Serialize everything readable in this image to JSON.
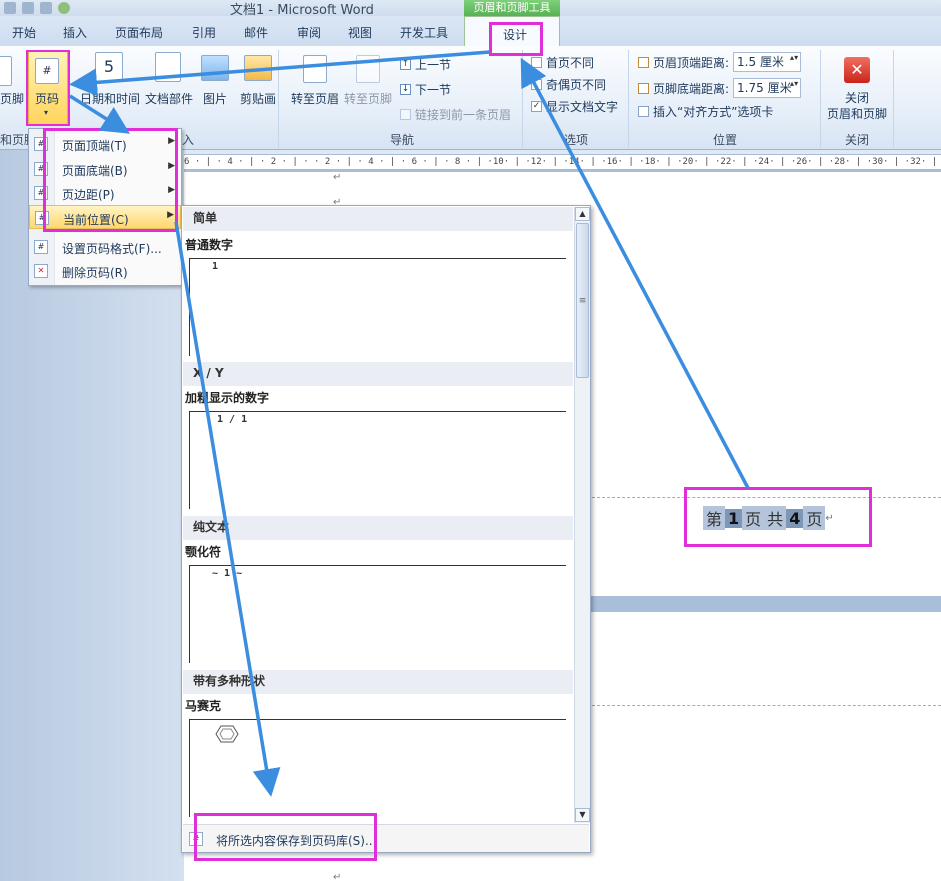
{
  "window": {
    "title": "文档1 - Microsoft Word",
    "context_tab_group": "页眉和页脚工具"
  },
  "tabs": {
    "items": [
      "开始",
      "插入",
      "页面布局",
      "引用",
      "邮件",
      "审阅",
      "视图",
      "开发工具"
    ],
    "active": "设计"
  },
  "ribbon": {
    "footer_partial": "页脚",
    "page_number": "页码",
    "date_time": "日期和时间",
    "doc_parts": "文档部件",
    "picture": "图片",
    "clipart": "剪贴画",
    "insert_group_partial": "入",
    "header_footer_group_partial": "和页脚",
    "goto_header": "转至页眉",
    "goto_footer": "转至页脚",
    "prev_section": "上一节",
    "next_section": "下一节",
    "link_prev": "链接到前一条页眉",
    "navigation_group": "导航",
    "diff_first": "首页不同",
    "diff_odd_even": "奇偶页不同",
    "show_doc_text": "显示文档文字",
    "options_group": "选项",
    "header_top_label": "页眉顶端距离:",
    "header_top_value": "1.5 厘米",
    "footer_bottom_label": "页脚底端距离:",
    "footer_bottom_value": "1.75 厘米",
    "insert_align_tab": "插入“对齐方式”选项卡",
    "position_group": "位置",
    "close_line1": "关闭",
    "close_line2": "页眉和页脚",
    "close_group": "关闭"
  },
  "ruler": {
    "text": "6 · | · 4 · | · 2 · | ·    · 2 · | · 4 · | · 6 · | · 8 · | ·10· | ·12· | ·14· | ·16· | ·18· | ·20· | ·22· | ·24· | ·26· | ·28· | ·30· | ·32· | ·34"
  },
  "menu": {
    "items": [
      {
        "label": "页面顶端(T)",
        "submenu": true
      },
      {
        "label": "页面底端(B)",
        "submenu": true
      },
      {
        "label": "页边距(P)",
        "submenu": true
      },
      {
        "label": "当前位置(C)",
        "submenu": true
      },
      {
        "label": "设置页码格式(F)...",
        "submenu": false
      },
      {
        "label": "删除页码(R)",
        "submenu": false
      }
    ]
  },
  "gallery": {
    "sections": [
      {
        "header": "简单",
        "item": "普通数字",
        "preview": "1"
      },
      {
        "header": "X / Y",
        "item": "加粗显示的数字",
        "preview": "1 / 1"
      },
      {
        "header": "纯文本",
        "item": "颚化符",
        "preview": "~ 1 ~"
      },
      {
        "header": "带有多种形状",
        "item": "马赛克",
        "preview": ""
      }
    ],
    "footer": "将所选内容保存到页码库(S)..."
  },
  "document": {
    "footer_parts": [
      "第",
      "1",
      "页",
      "共",
      "4",
      "页"
    ]
  },
  "colors": {
    "annotation": "#e02fd8",
    "arrow": "#3b8de0",
    "context_tab": "#58b154"
  }
}
